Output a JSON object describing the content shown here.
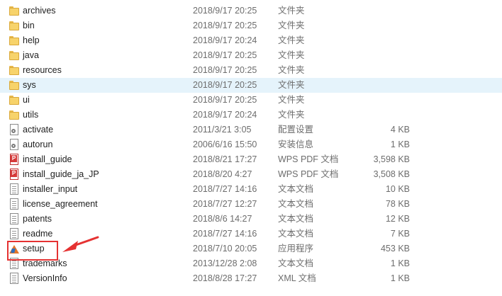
{
  "files": [
    {
      "name": "archives",
      "date": "2018/9/17 20:25",
      "type": "文件夹",
      "size": "",
      "icon": "folder-icon"
    },
    {
      "name": "bin",
      "date": "2018/9/17 20:25",
      "type": "文件夹",
      "size": "",
      "icon": "folder-icon"
    },
    {
      "name": "help",
      "date": "2018/9/17 20:24",
      "type": "文件夹",
      "size": "",
      "icon": "folder-icon"
    },
    {
      "name": "java",
      "date": "2018/9/17 20:25",
      "type": "文件夹",
      "size": "",
      "icon": "folder-icon"
    },
    {
      "name": "resources",
      "date": "2018/9/17 20:25",
      "type": "文件夹",
      "size": "",
      "icon": "folder-icon"
    },
    {
      "name": "sys",
      "date": "2018/9/17 20:25",
      "type": "文件夹",
      "size": "",
      "icon": "folder-icon"
    },
    {
      "name": "ui",
      "date": "2018/9/17 20:25",
      "type": "文件夹",
      "size": "",
      "icon": "folder-icon"
    },
    {
      "name": "utils",
      "date": "2018/9/17 20:24",
      "type": "文件夹",
      "size": "",
      "icon": "folder-icon"
    },
    {
      "name": "activate",
      "date": "2011/3/21 3:05",
      "type": "配置设置",
      "size": "4 KB",
      "icon": "settings-file-icon"
    },
    {
      "name": "autorun",
      "date": "2006/6/16 15:50",
      "type": "安装信息",
      "size": "1 KB",
      "icon": "settings-file-icon"
    },
    {
      "name": "install_guide",
      "date": "2018/8/21 17:27",
      "type": "WPS PDF 文档",
      "size": "3,598 KB",
      "icon": "pdf-file-icon"
    },
    {
      "name": "install_guide_ja_JP",
      "date": "2018/8/20 4:27",
      "type": "WPS PDF 文档",
      "size": "3,508 KB",
      "icon": "pdf-file-icon"
    },
    {
      "name": "installer_input",
      "date": "2018/7/27 14:16",
      "type": "文本文档",
      "size": "10 KB",
      "icon": "text-file-icon"
    },
    {
      "name": "license_agreement",
      "date": "2018/7/27 12:27",
      "type": "文本文档",
      "size": "78 KB",
      "icon": "text-file-icon"
    },
    {
      "name": "patents",
      "date": "2018/8/6 14:27",
      "type": "文本文档",
      "size": "12 KB",
      "icon": "text-file-icon"
    },
    {
      "name": "readme",
      "date": "2018/7/27 14:16",
      "type": "文本文档",
      "size": "7 KB",
      "icon": "text-file-icon"
    },
    {
      "name": "setup",
      "date": "2018/7/10 20:05",
      "type": "应用程序",
      "size": "453 KB",
      "icon": "application-icon"
    },
    {
      "name": "trademarks",
      "date": "2013/12/28 2:08",
      "type": "文本文档",
      "size": "1 KB",
      "icon": "text-file-icon"
    },
    {
      "name": "VersionInfo",
      "date": "2018/8/28 17:27",
      "type": "XML 文档",
      "size": "1 KB",
      "icon": "text-file-icon"
    }
  ],
  "hovered_row": "sys",
  "highlighted_item": "setup",
  "annotation_color": "#e53232",
  "hover_color": "#e5f3fb"
}
